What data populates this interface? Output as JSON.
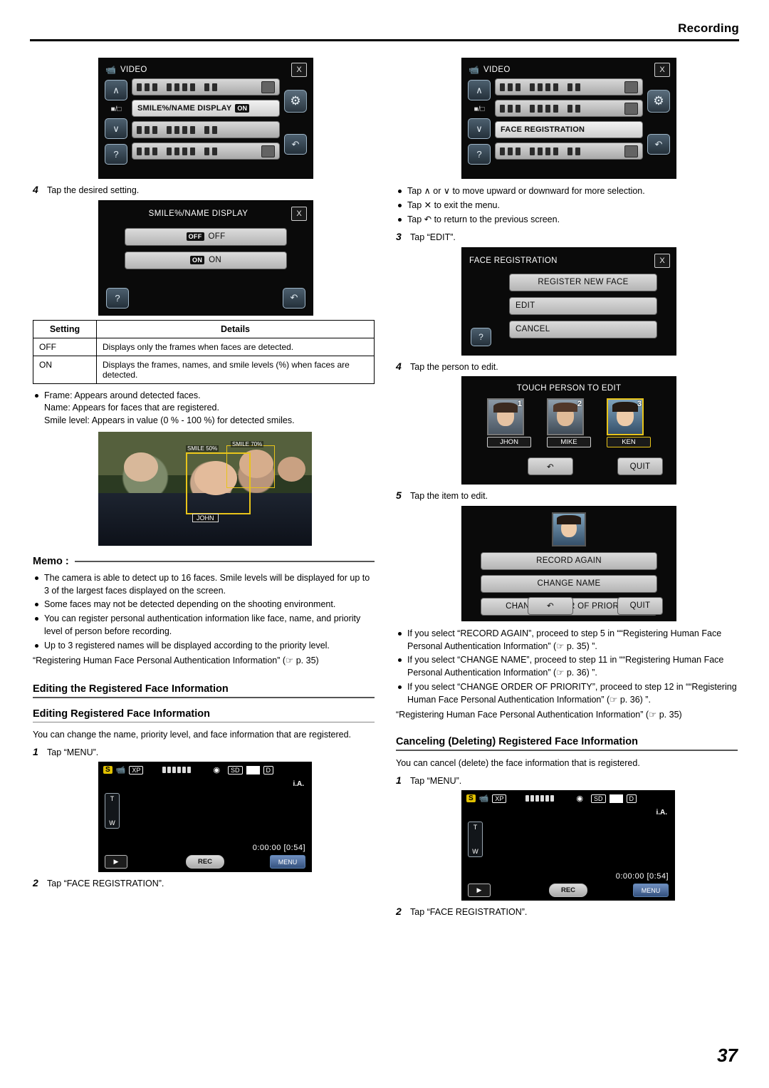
{
  "header": {
    "title": "Recording",
    "page_number": "37"
  },
  "left": {
    "screen1": {
      "title": "VIDEO",
      "close_icon": "X",
      "up_icon": "∧",
      "down_icon": "∨",
      "help_icon": "?",
      "gear_icon": "⚙",
      "back_icon": "↶",
      "row2_label": "SMILE%/NAME DISPLAY",
      "row2_badge": "ON"
    },
    "step4": {
      "n": "4",
      "text": "Tap the desired setting."
    },
    "screen2": {
      "title": "SMILE%/NAME DISPLAY",
      "close_icon": "X",
      "help_icon": "?",
      "back_icon": "↶",
      "option_off_badge": "OFF",
      "option_off": "OFF",
      "option_on_badge": "ON",
      "option_on": "ON"
    },
    "table": {
      "headers": [
        "Setting",
        "Details"
      ],
      "rows": [
        [
          "OFF",
          "Displays only the frames when faces are detected."
        ],
        [
          "ON",
          "Displays the frames, names, and smile levels (%) when faces are detected."
        ]
      ]
    },
    "notes": [
      "Frame: Appears around detected faces.\nName: Appears for faces that are registered.\nSmile level: Appears in value (0 % - 100 %) for detected smiles."
    ],
    "photo": {
      "smile_tag_left": "SMILE 50%",
      "smile_tag_right": "SMILE 70%",
      "name_tag": "JOHN"
    },
    "memo": {
      "title": "Memo :",
      "items": [
        "The camera is able to detect up to 16 faces. Smile levels will be displayed for up to 3 of the largest faces displayed on the screen.",
        "Some faces may not be detected depending on the shooting environment.",
        "You can register personal authentication information like face, name, and priority level of person before recording.",
        "Up to 3 registered names will be displayed according to the priority level."
      ],
      "footer": "“Registering Human Face Personal Authentication Information” (☞ p. 35)"
    },
    "section_title": "Editing the Registered Face Information",
    "sub_title": "Editing Registered Face Information",
    "sub_body": "You can change the name, priority level, and face information that are registered.",
    "step1": {
      "n": "1",
      "text": "Tap “MENU”."
    },
    "cam": {
      "s_icon": "S",
      "video_icon": "■",
      "xp": "XP",
      "sd": "SD",
      "d": "D",
      "ia": "i.A.",
      "t": "T",
      "w": "W",
      "timecode": "0:00:00 [0:54]",
      "play_icon": "▶",
      "rec_label": "REC",
      "menu_label": "MENU"
    },
    "step2": {
      "n": "2",
      "text": "Tap “FACE REGISTRATION”."
    }
  },
  "right": {
    "screen1": {
      "title": "VIDEO",
      "close_icon": "X",
      "up_icon": "∧",
      "down_icon": "∨",
      "help_icon": "?",
      "gear_icon": "⚙",
      "back_icon": "↶",
      "row3_label": "FACE REGISTRATION"
    },
    "bullets": [
      "Tap ∧ or ∨ to move upward or downward for more selection.",
      "Tap ✕ to exit the menu.",
      "Tap ↶ to return to the previous screen."
    ],
    "step3": {
      "n": "3",
      "text": "Tap “EDIT”."
    },
    "screen_face_reg": {
      "title": "FACE REGISTRATION",
      "close_icon": "X",
      "help_icon": "?",
      "buttons": [
        "REGISTER NEW FACE",
        "EDIT",
        "CANCEL"
      ]
    },
    "step4": {
      "n": "4",
      "text": "Tap the person to edit."
    },
    "screen_touch_person": {
      "title": "TOUCH PERSON TO EDIT",
      "faces": [
        {
          "num": "1",
          "name": "JHON"
        },
        {
          "num": "2",
          "name": "MIKE"
        },
        {
          "num": "3",
          "name": "KEN"
        }
      ],
      "back_icon": "↶",
      "quit_label": "QUIT"
    },
    "step5": {
      "n": "5",
      "text": "Tap the item to edit."
    },
    "screen_edit_items": {
      "buttons": [
        "RECORD AGAIN",
        "CHANGE NAME",
        "CHANGE ORDER OF PRIORITY"
      ],
      "back_icon": "↶",
      "quit_label": "QUIT"
    },
    "bullets2": [
      "If you select “RECORD AGAIN”, proceed to step 5 in ““Registering Human Face Personal Authentication Information” (☞ p. 35) ”.",
      "If you select “CHANGE NAME”, proceed to step 11 in ““Registering Human Face Personal Authentication Information” (☞ p. 36) ”.",
      "If you select “CHANGE ORDER OF PRIORITY”, proceed to step 12 in ““Registering Human Face Personal Authentication Information” (☞ p. 36) ”."
    ],
    "after_note": "“Registering Human Face Personal Authentication Information” (☞ p. 35)",
    "section_title": "Canceling (Deleting) Registered Face Information",
    "section_body": "You can cancel (delete) the face information that is registered.",
    "step1": {
      "n": "1",
      "text": "Tap “MENU”."
    },
    "cam": {
      "s_icon": "S",
      "xp": "XP",
      "sd": "SD",
      "d": "D",
      "ia": "i.A.",
      "t": "T",
      "w": "W",
      "timecode": "0:00:00 [0:54]",
      "play_icon": "▶",
      "rec_label": "REC",
      "menu_label": "MENU"
    },
    "step2": {
      "n": "2",
      "text": "Tap “FACE REGISTRATION”."
    }
  }
}
